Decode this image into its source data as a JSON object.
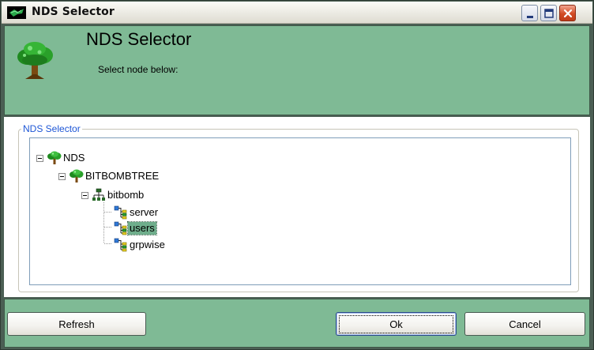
{
  "window": {
    "title": "NDS Selector",
    "controls": [
      "minimize",
      "maximize",
      "close"
    ]
  },
  "header": {
    "title": "NDS Selector",
    "subtitle": "Select node below:",
    "icon": "tree-icon"
  },
  "group": {
    "legend": "NDS Selector"
  },
  "tree": {
    "root": {
      "label": "NDS",
      "icon": "tree-icon",
      "expanded": true
    },
    "tree_node": {
      "label": "BITBOMBTREE",
      "icon": "tree-icon",
      "expanded": true
    },
    "org": {
      "label": "bitbomb",
      "icon": "org-unit-icon",
      "expanded": true
    },
    "children": [
      {
        "label": "server",
        "icon": "org-container-icon",
        "selected": false
      },
      {
        "label": "users",
        "icon": "org-container-icon",
        "selected": true
      },
      {
        "label": "grpwise",
        "icon": "org-container-icon",
        "selected": false
      }
    ]
  },
  "footer": {
    "refresh_label": "Refresh",
    "ok_label": "Ok",
    "cancel_label": "Cancel"
  }
}
